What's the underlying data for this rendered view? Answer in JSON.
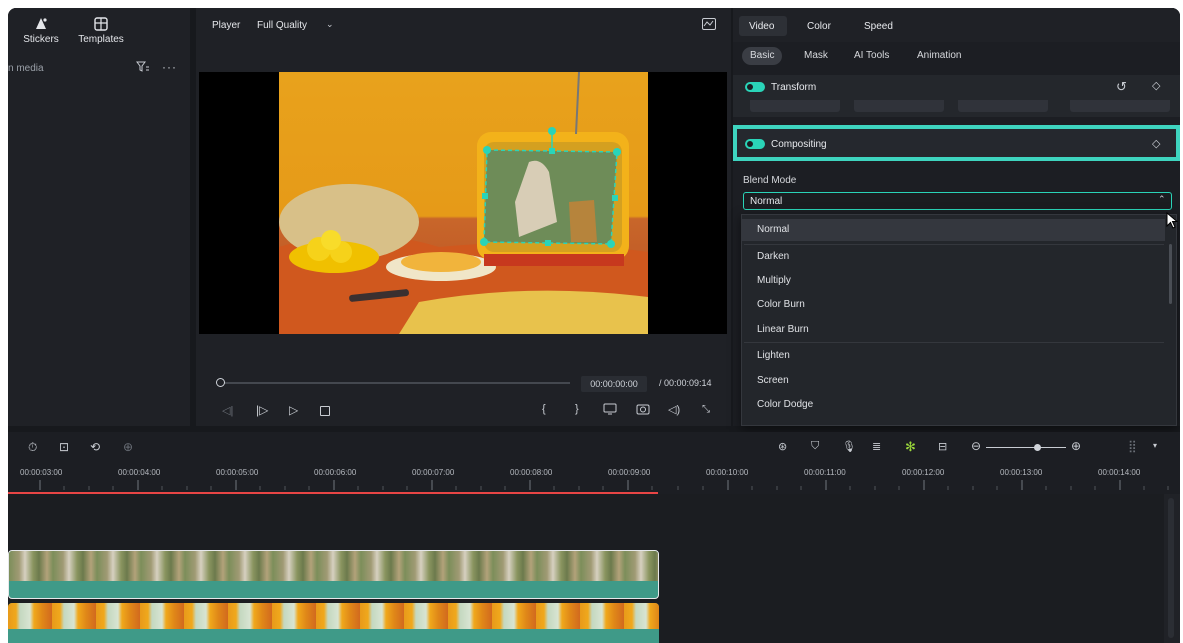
{
  "media_panel": {
    "tools": [
      {
        "label": "Stickers",
        "icon": "sticker-icon"
      },
      {
        "label": "Templates",
        "icon": "templates-icon"
      }
    ],
    "search_text": "n media",
    "filter_icon": "filter-icon",
    "more_icon": "more-icon"
  },
  "player": {
    "label": "Player",
    "quality": "Full Quality",
    "chart_icon": "waveform-icon",
    "current_time": "00:00:00:00",
    "total_time": "/ 00:00:09:14"
  },
  "properties": {
    "tabs": [
      "Video",
      "Color",
      "Speed"
    ],
    "active_tab": "Video",
    "subtabs": [
      "Basic",
      "Mask",
      "AI Tools",
      "Animation"
    ],
    "active_subtab": "Basic",
    "transform_label": "Transform",
    "compositing_label": "Compositing",
    "blend_mode_label": "Blend Mode",
    "blend_mode_value": "Normal",
    "blend_options": [
      "Normal",
      "Darken",
      "Multiply",
      "Color Burn",
      "Linear Burn",
      "Lighten",
      "Screen",
      "Color Dodge"
    ]
  },
  "timeline": {
    "ticks": [
      "00:00:03:00",
      "00:00:04:00",
      "00:00:05:00",
      "00:00:06:00",
      "00:00:07:00",
      "00:00:08:00",
      "00:00:09:00",
      "00:00:10:00",
      "00:00:11:00",
      "00:00:12:00",
      "00:00:13:00",
      "00:00:14:00"
    ],
    "progress": 0.56
  },
  "colors": {
    "accent": "#2ad4b8",
    "playhead": "#e84545",
    "clip": "#3f9a88"
  }
}
